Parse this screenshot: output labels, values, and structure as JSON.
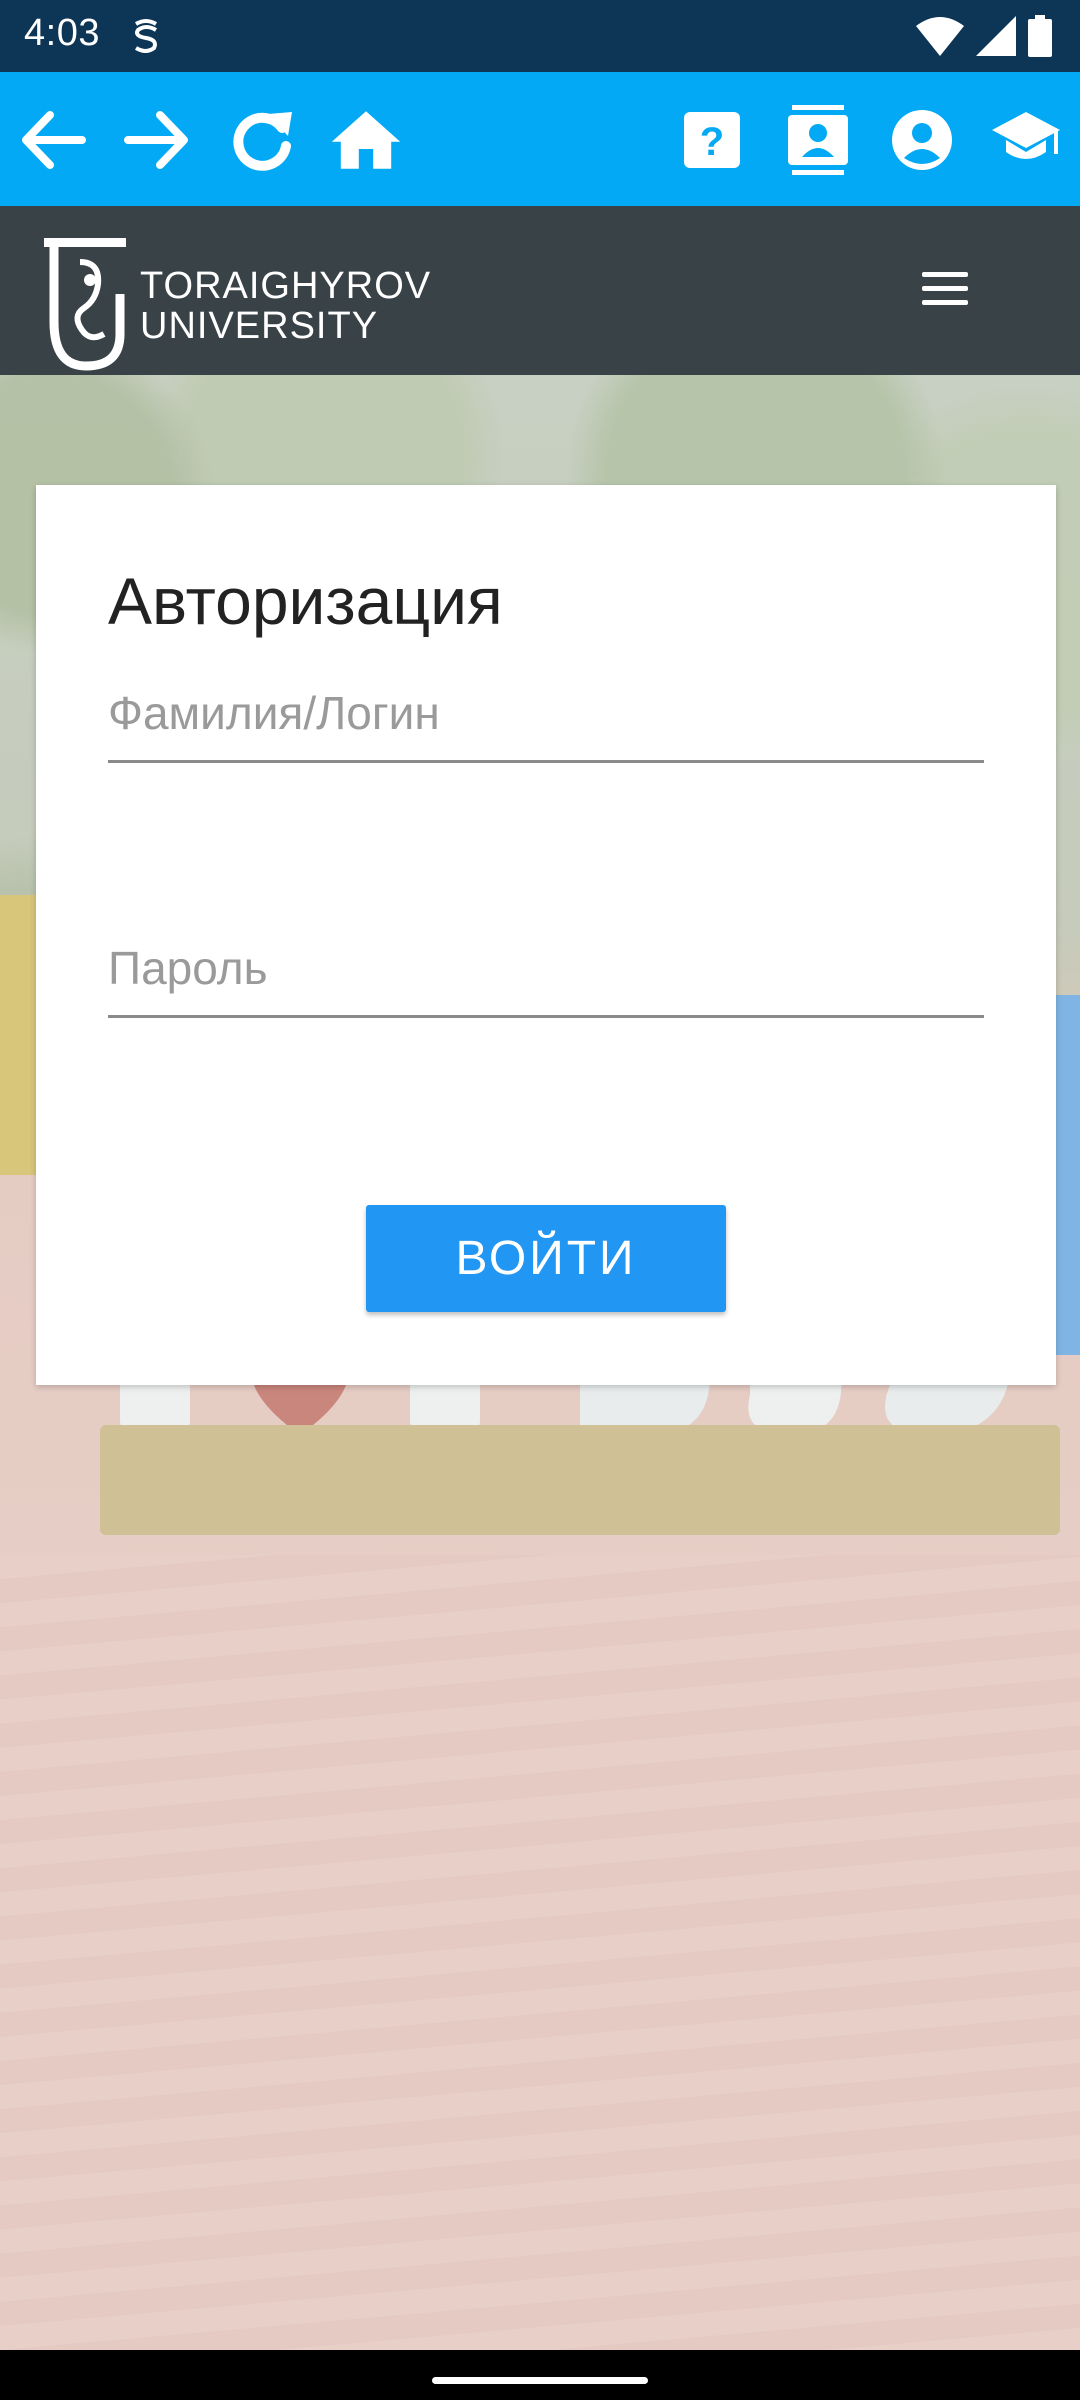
{
  "status_bar": {
    "time": "4:03",
    "icons": [
      "app-notification-icon",
      "wifi-icon",
      "signal-icon",
      "battery-icon"
    ]
  },
  "toolbar": {
    "buttons": [
      "back-icon",
      "forward-icon",
      "reload-icon",
      "home-icon",
      "help-icon",
      "contacts-icon",
      "account-icon",
      "education-icon"
    ]
  },
  "header": {
    "logo_line1": "TORAIGHYROV",
    "logo_line2": "UNIVERSITY",
    "menu_icon": "hamburger-menu-icon"
  },
  "login_card": {
    "title": "Авторизация",
    "login_placeholder": "Фамилия/Логин",
    "password_placeholder": "Пароль",
    "submit_label": "ВОЙТИ"
  },
  "colors": {
    "status_bar": "#0d3556",
    "toolbar": "#03a9f4",
    "header": "#394247",
    "button": "#2196f3"
  }
}
